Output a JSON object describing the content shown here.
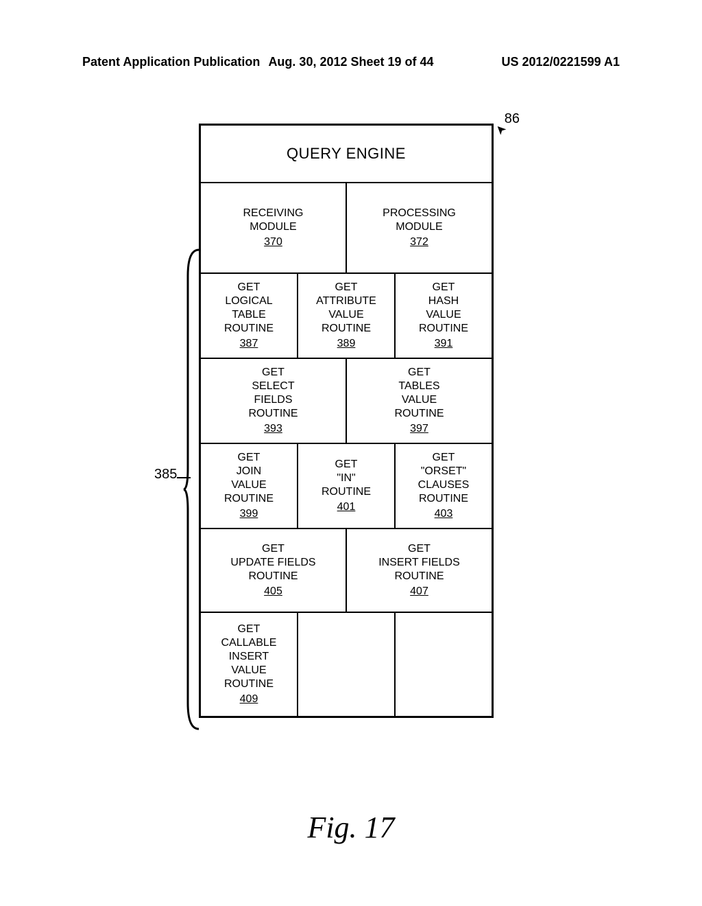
{
  "header": {
    "left": "Patent Application Publication",
    "middle": "Aug. 30, 2012  Sheet 19 of 44",
    "right": "US 2012/0221599 A1"
  },
  "diagram": {
    "pointer_label": "86",
    "title": "QUERY ENGINE",
    "side_label": "385",
    "modules_row": [
      {
        "lines": [
          "RECEIVING",
          "MODULE"
        ],
        "num": "370"
      },
      {
        "lines": [
          "PROCESSING",
          "MODULE"
        ],
        "num": "372"
      }
    ],
    "rows": [
      [
        {
          "lines": [
            "GET",
            "LOGICAL",
            "TABLE",
            "ROUTINE"
          ],
          "num": "387"
        },
        {
          "lines": [
            "GET",
            "ATTRIBUTE",
            "VALUE",
            "ROUTINE"
          ],
          "num": "389"
        },
        {
          "lines": [
            "GET",
            "HASH",
            "VALUE",
            "ROUTINE"
          ],
          "num": "391"
        }
      ],
      [
        {
          "lines": [
            "GET",
            "SELECT",
            "FIELDS",
            "ROUTINE"
          ],
          "num": "393"
        },
        {
          "lines": [
            "GET",
            "TABLES",
            "VALUE",
            "ROUTINE"
          ],
          "num": "397"
        }
      ],
      [
        {
          "lines": [
            "GET",
            "JOIN",
            "VALUE",
            "ROUTINE"
          ],
          "num": "399"
        },
        {
          "lines": [
            "GET",
            "\"IN\"",
            "ROUTINE",
            ""
          ],
          "num": "401"
        },
        {
          "lines": [
            "GET",
            "\"ORSET\"",
            "CLAUSES",
            "ROUTINE"
          ],
          "num": "403"
        }
      ],
      [
        {
          "lines": [
            "GET",
            "UPDATE FIELDS",
            "ROUTINE",
            ""
          ],
          "num": "405"
        },
        {
          "lines": [
            "GET",
            "INSERT FIELDS",
            "ROUTINE",
            ""
          ],
          "num": "407"
        }
      ],
      [
        {
          "lines": [
            "GET",
            "CALLABLE",
            "INSERT",
            "VALUE",
            "ROUTINE"
          ],
          "num": "409"
        },
        {
          "empty": true
        },
        {
          "empty": true
        }
      ]
    ]
  },
  "caption": "Fig. 17"
}
